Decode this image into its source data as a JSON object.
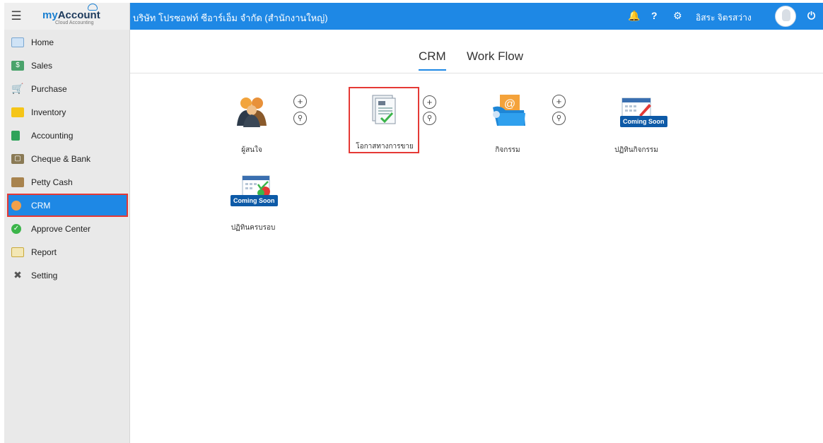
{
  "app": {
    "logo_brand_my": "my",
    "logo_brand_account": "Account",
    "logo_sub": "Cloud Accounting",
    "company": "บริษัท โปรซอฟท์ ซีอาร์เอ็ม จำกัด (สำนักงานใหญ่)",
    "user_name": "อิสระ จิตรสว่าง",
    "help_label": "?",
    "accent_color": "#1e88e5"
  },
  "sidebar": {
    "items": [
      {
        "label": "Home",
        "icon": "home-icon"
      },
      {
        "label": "Sales",
        "icon": "sales-icon"
      },
      {
        "label": "Purchase",
        "icon": "cart-icon"
      },
      {
        "label": "Inventory",
        "icon": "box-icon"
      },
      {
        "label": "Accounting",
        "icon": "book-icon"
      },
      {
        "label": "Cheque & Bank",
        "icon": "bank-icon"
      },
      {
        "label": "Petty Cash",
        "icon": "wallet-icon"
      },
      {
        "label": "CRM",
        "icon": "crm-icon"
      },
      {
        "label": "Approve Center",
        "icon": "check-icon"
      },
      {
        "label": "Report",
        "icon": "report-icon"
      },
      {
        "label": "Setting",
        "icon": "tools-icon"
      }
    ],
    "active": "CRM"
  },
  "tabs": [
    {
      "label": "CRM"
    },
    {
      "label": "Work Flow"
    }
  ],
  "tiles": [
    {
      "label": "ผู้สนใจ"
    },
    {
      "label": "โอกาสทางการขาย"
    },
    {
      "label": "กิจกรรม"
    },
    {
      "label": "ปฏิทินกิจกรรม",
      "badge": "Coming Soon"
    },
    {
      "label": "ปฏิทินครบรอบ",
      "badge": "Coming Soon"
    }
  ]
}
